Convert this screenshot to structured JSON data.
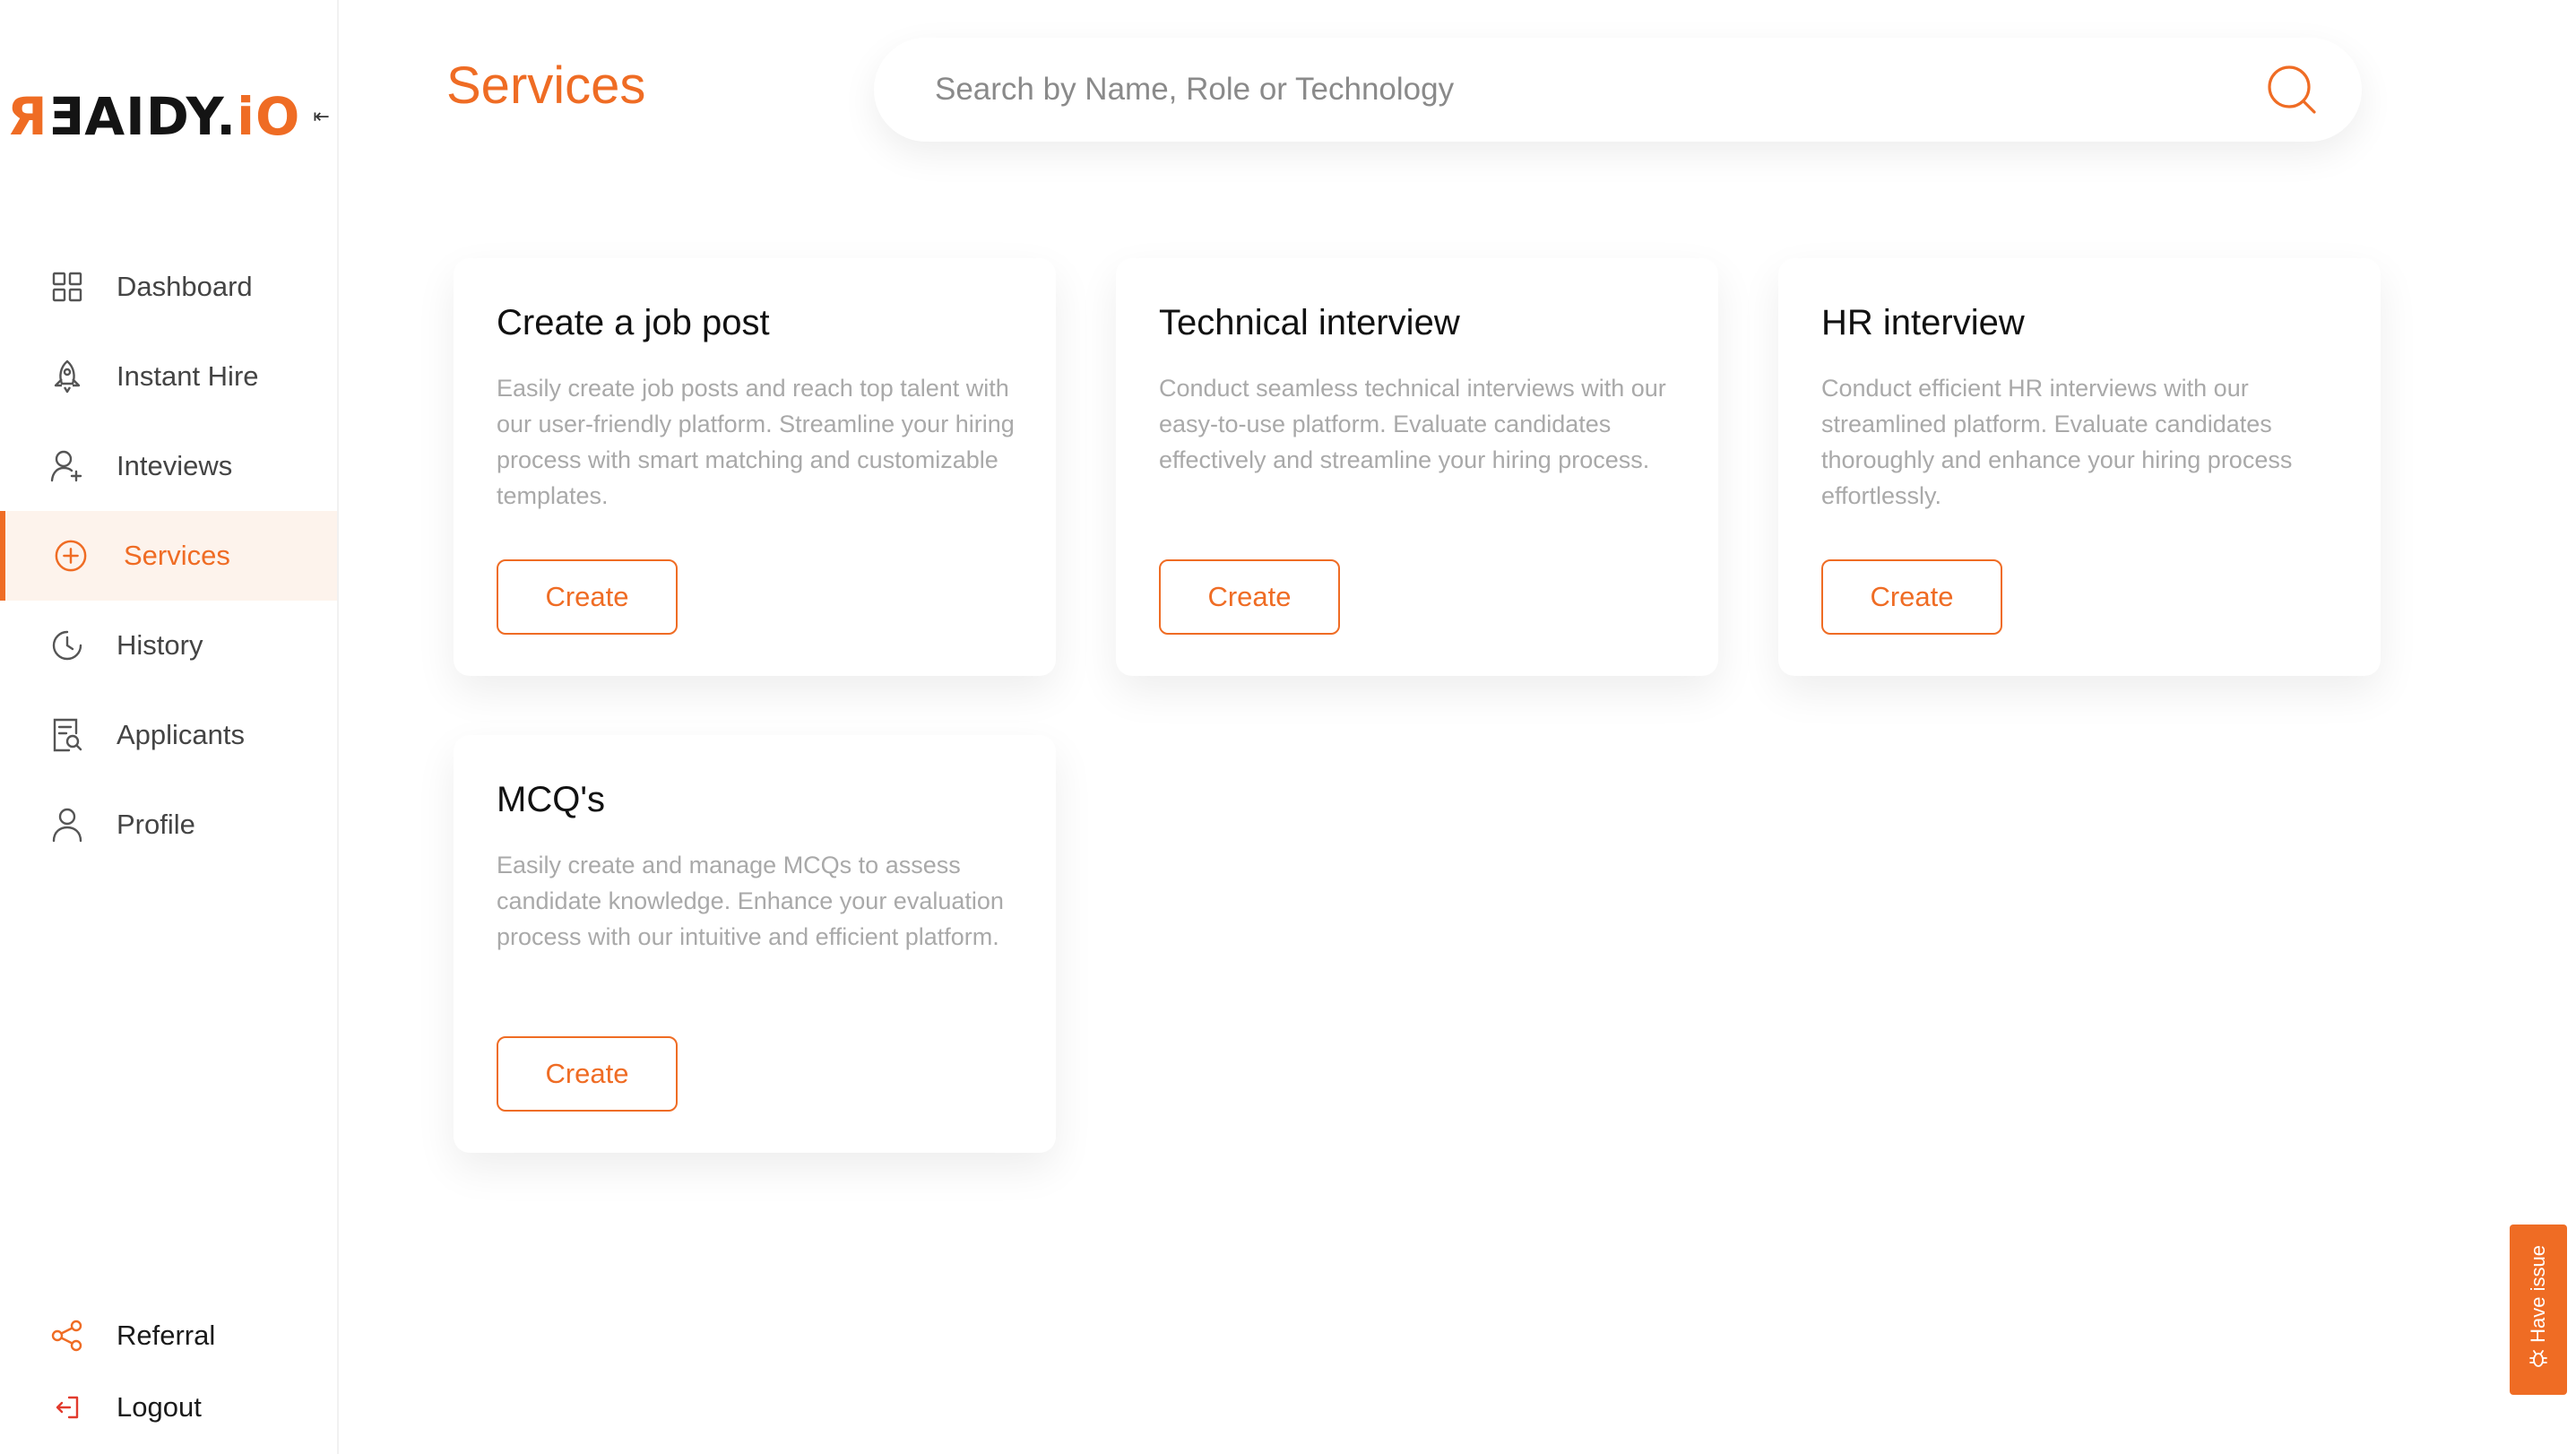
{
  "brand": {
    "logo_text_main": "ƎAIDY.",
    "logo_text_accent_left": "Я",
    "logo_text_accent_right": "iO",
    "accent_color": "#ef6c24",
    "collapse_icon": "collapse-left-icon"
  },
  "sidebar": {
    "items": [
      {
        "label": "Dashboard",
        "icon": "grid-icon"
      },
      {
        "label": "Instant Hire",
        "icon": "rocket-icon"
      },
      {
        "label": "Inteviews",
        "icon": "user-add-icon"
      },
      {
        "label": "Services",
        "icon": "plus-circle-icon",
        "active": true
      },
      {
        "label": "History",
        "icon": "clock-icon"
      },
      {
        "label": "Applicants",
        "icon": "document-search-icon"
      },
      {
        "label": "Profile",
        "icon": "user-icon"
      }
    ],
    "bottom": [
      {
        "label": "Referral",
        "icon": "share-icon"
      },
      {
        "label": "Logout",
        "icon": "logout-icon"
      }
    ]
  },
  "header": {
    "title": "Services",
    "search_placeholder": "Search by Name, Role or Technology",
    "search_value": ""
  },
  "cards": [
    {
      "title": "Create a job post",
      "description": "Easily create job posts and reach top talent with our user-friendly platform. Streamline your hiring process with smart matching and customizable templates.",
      "button": "Create"
    },
    {
      "title": "Technical interview",
      "description": "Conduct seamless technical interviews with our easy-to-use platform. Evaluate candidates effectively and streamline your hiring process.",
      "button": "Create"
    },
    {
      "title": "HR interview",
      "description": "Conduct efficient HR interviews with our streamlined platform. Evaluate candidates thoroughly and enhance your hiring process effortlessly.",
      "button": "Create"
    },
    {
      "title": "MCQ's",
      "description": "Easily create and manage MCQs to assess candidate knowledge. Enhance your evaluation process with our intuitive and efficient platform.",
      "button": "Create"
    }
  ],
  "feedback": {
    "label": "Have issue",
    "icon": "bug-icon"
  }
}
